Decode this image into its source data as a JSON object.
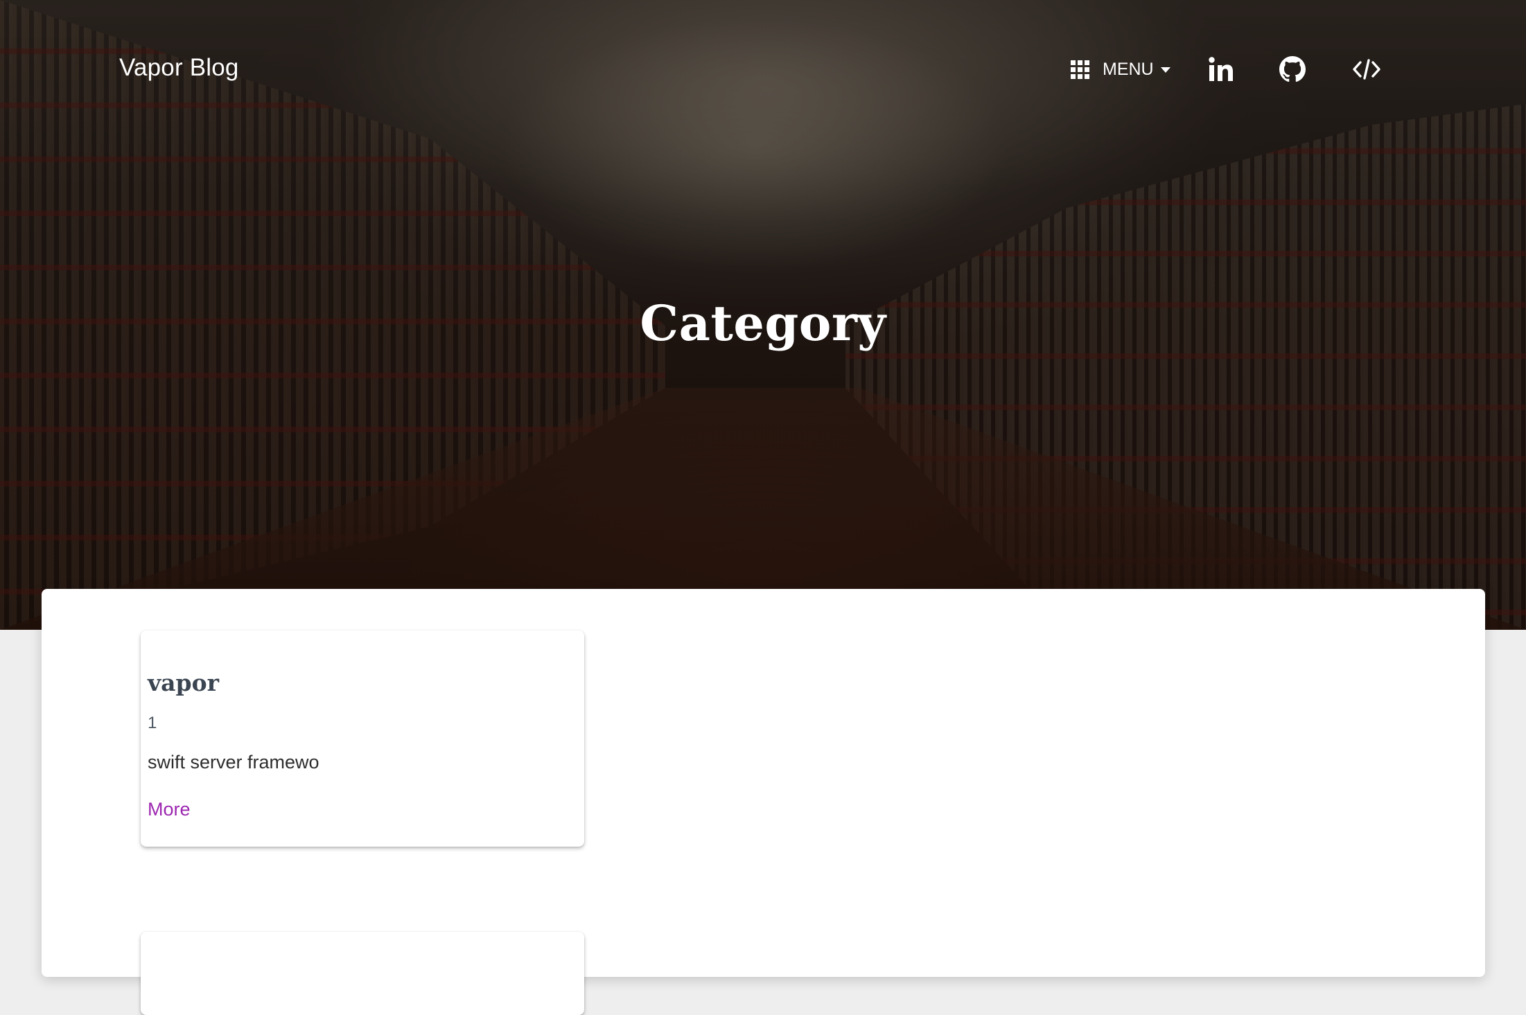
{
  "nav": {
    "brand": "Vapor Blog",
    "menu_label": "MENU",
    "icons": [
      "grid-icon",
      "caret-down-icon",
      "linkedin-icon",
      "github-icon",
      "code-icon"
    ]
  },
  "hero": {
    "title": "Category"
  },
  "categories": [
    {
      "name": "vapor",
      "count": "1",
      "description": "swift server framewo",
      "link_label": "More"
    }
  ],
  "colors": {
    "link": "#9c27b0",
    "card_title": "#3b4551",
    "hero_text": "#ffffff",
    "page_background": "#eeeeee"
  }
}
